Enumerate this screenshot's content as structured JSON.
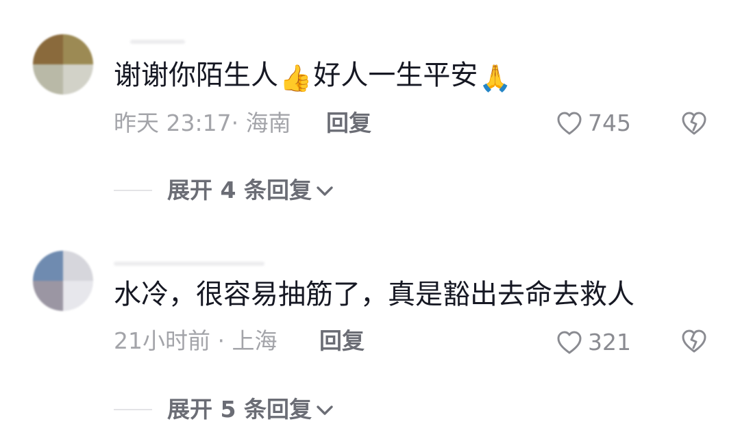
{
  "comments": [
    {
      "text_before": "谢谢你陌生人",
      "emoji1": "👍",
      "text_after": "好人一生平安",
      "emoji2": "🙏",
      "meta": "昨天 23:17· 海南",
      "reply_label": "回复",
      "like_count": "745",
      "expand_label": "展开 4 条回复"
    },
    {
      "text_before": "水冷，很容易抽筋了，真是豁出去命去救人",
      "emoji1": "",
      "text_after": "",
      "emoji2": "",
      "meta": "21小时前 · 上海",
      "reply_label": "回复",
      "like_count": "321",
      "expand_label": "展开 5 条回复"
    }
  ],
  "icons": {
    "like": "heart-outline-icon",
    "dislike": "broken-heart-icon",
    "expand": "chevron-down-icon"
  },
  "colors": {
    "primary_text": "#161823",
    "meta_text": "#a3a4a9",
    "action_text": "#6b6d75",
    "icon_stroke": "#8a8b91"
  }
}
